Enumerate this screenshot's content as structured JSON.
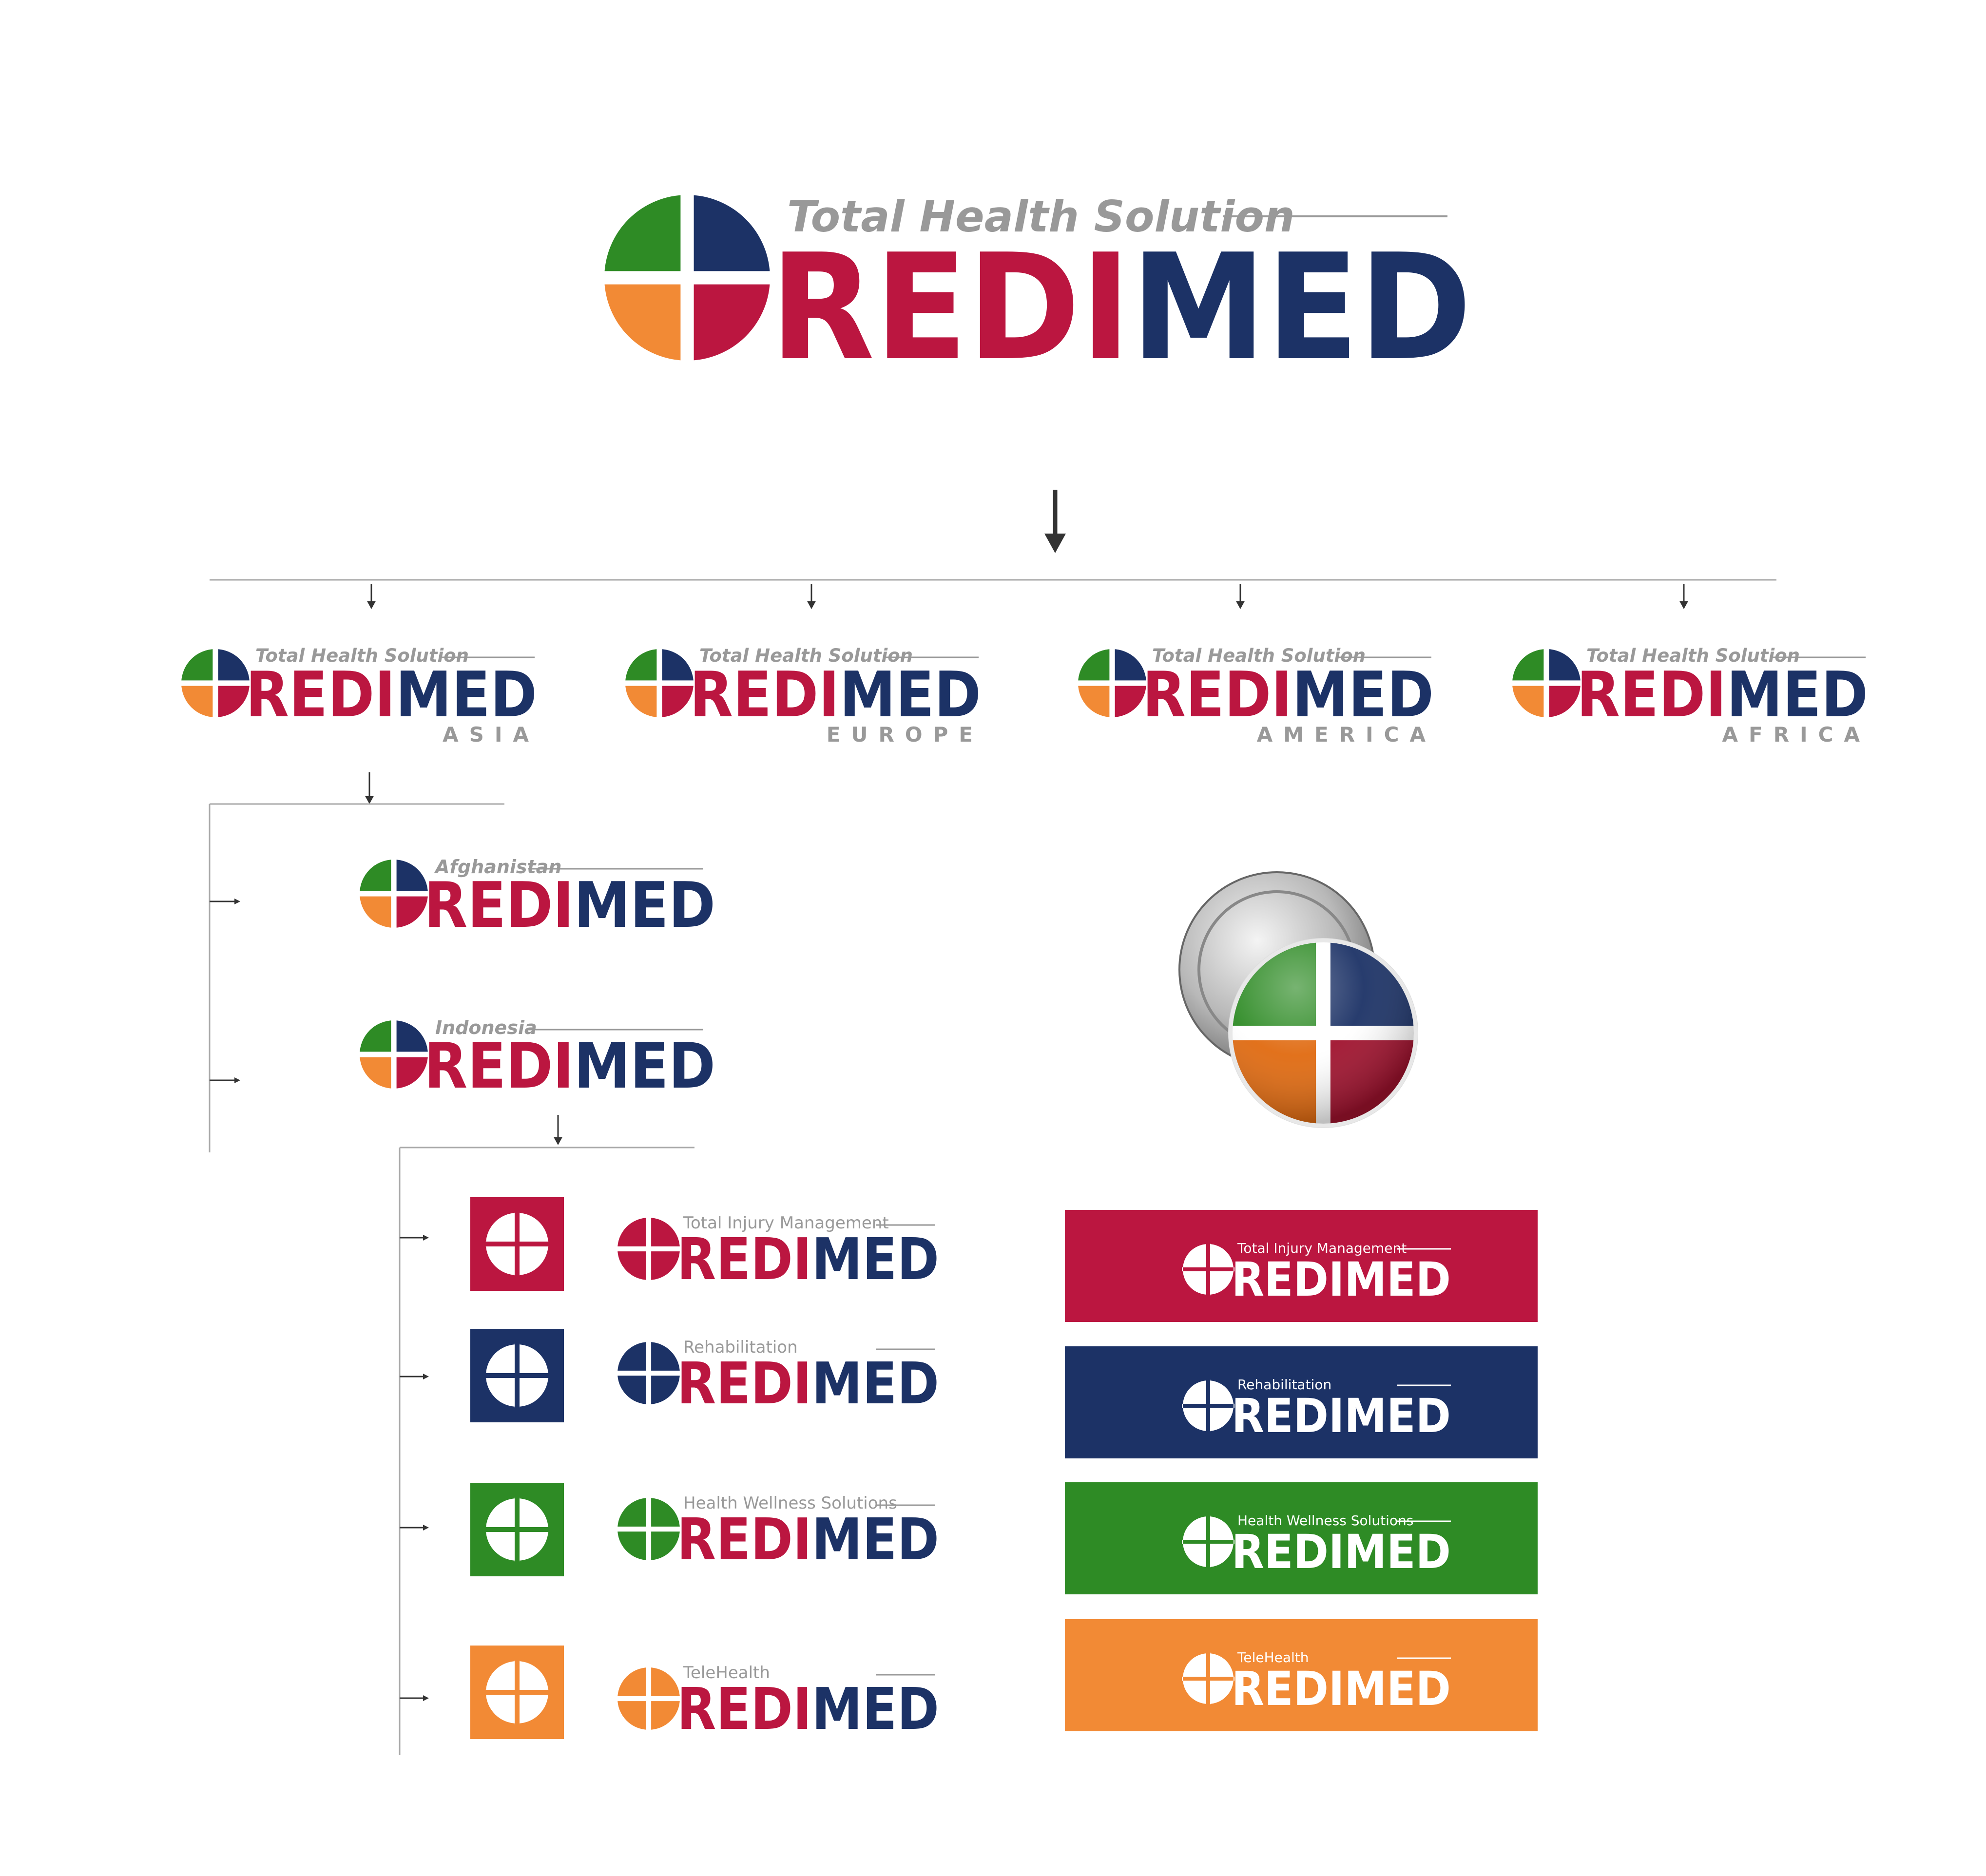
{
  "colors": {
    "red": "#BB1640",
    "navy": "#1C3266",
    "green": "#2E8B25",
    "orange": "#F28A35",
    "grey": "#999999",
    "line": "#AAAAAA",
    "arrow": "#333333",
    "white": "#FFFFFF"
  },
  "brand": {
    "red_part": "REDI",
    "blue_part": "MED"
  },
  "main_logo": {
    "tagline": "Total Health Solution"
  },
  "regions": [
    {
      "tagline": "Total Health Solution",
      "region": "ASIA"
    },
    {
      "tagline": "Total Health Solution",
      "region": "EUROPE"
    },
    {
      "tagline": "Total Health Solution",
      "region": "AMERICA"
    },
    {
      "tagline": "Total Health Solution",
      "region": "AFRICA"
    }
  ],
  "countries": [
    {
      "tagline": "Afghanistan"
    },
    {
      "tagline": "Indonesia"
    }
  ],
  "services": [
    {
      "tagline": "Total Injury Management",
      "color": "#BB1640"
    },
    {
      "tagline": "Rehabilitation",
      "color": "#1C3266"
    },
    {
      "tagline": "Health Wellness Solutions",
      "color": "#2E8B25"
    },
    {
      "tagline": "TeleHealth",
      "color": "#F28A35"
    }
  ],
  "badge": {
    "icon": "cross-badge-pin-icon"
  }
}
